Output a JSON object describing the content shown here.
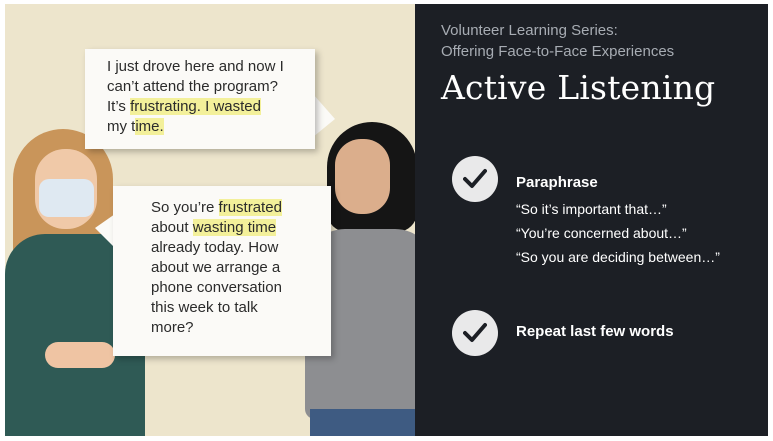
{
  "right_panel": {
    "series_line1": "Volunteer Learning Series:",
    "series_line2": "Offering Face-to-Face Experiences",
    "title": "Active Listening",
    "items": [
      {
        "icon": "checkmark-icon",
        "title": "Paraphrase",
        "quotes": [
          "“So it’s important that…”",
          "“You’re concerned about…”",
          "“So you are deciding between…”"
        ]
      },
      {
        "icon": "checkmark-icon",
        "title": "Repeat last few words"
      }
    ]
  },
  "bubble1": {
    "l1": "I just drove here and now I",
    "l2": "can’t attend the program?",
    "l3a": "It’s ",
    "l3b": "frustrating.  I wasted",
    "l4a": "my t",
    "l4b": "ime."
  },
  "bubble2": {
    "l1a": "So you’re ",
    "l1b": "frustrated",
    "l2a": "about ",
    "l2b": "wasting time",
    "l3": "already today. How",
    "l4": "about we arrange a",
    "l5": "phone conversation",
    "l6": "this week to talk",
    "l7": "more?"
  },
  "colors": {
    "left_bg": "#ede5cc",
    "right_bg": "#1c1f25",
    "highlight": "#f3f09a"
  }
}
